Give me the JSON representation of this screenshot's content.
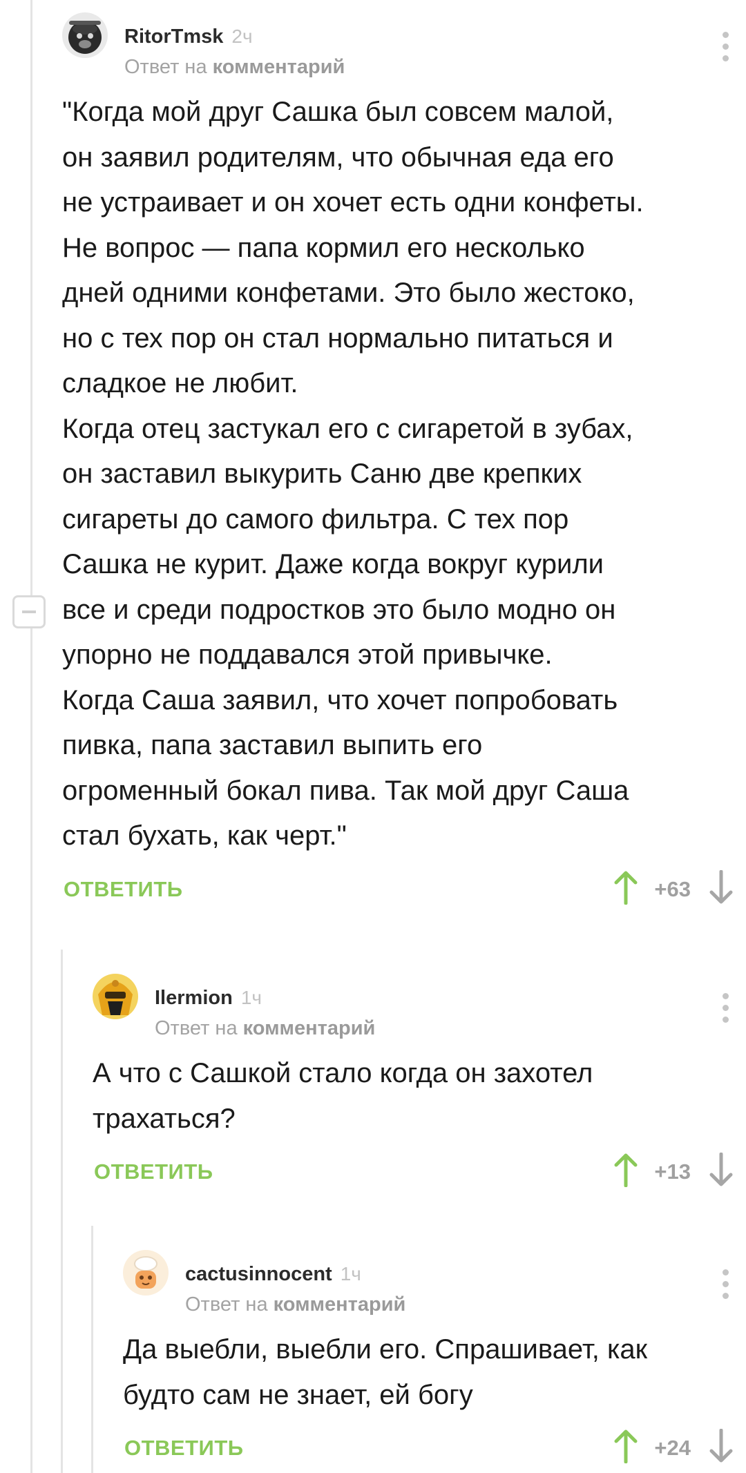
{
  "comments": [
    {
      "author": "RitorTmsk",
      "time": "2ч",
      "reply_prefix": "Ответ на",
      "reply_link": "комментарий",
      "body": [
        "\"Когда мой друг Сашка был совсем малой,",
        "он заявил родителям, что обычная еда его",
        "не устраивает и он хочет есть одни конфеты.",
        "Не вопрос — папа кормил его несколько",
        "дней одними конфетами. Это было жестоко,",
        "но с тех пор он стал нормально питаться и",
        "сладкое не любит.",
        "Когда отец застукал его с сигаретой в зубах,",
        "он заставил выкурить Саню две крепких",
        "сигареты до самого фильтра. С тех пор",
        "Сашка не курит. Даже когда вокруг курили",
        "все и среди подростков это было модно он",
        "упорно не поддавался этой привычке.",
        "Когда Саша заявил, что хочет попробовать",
        "пивка, папа заставил выпить его",
        "огроменный бокал пива. Так мой друг Саша",
        "стал бухать, как черт.\""
      ],
      "reply_button": "ОТВЕТИТЬ",
      "score": "+63",
      "avatar_icon": "bulldog-avatar-icon"
    },
    {
      "author": "Ilermion",
      "time": "1ч",
      "reply_prefix": "Ответ на",
      "reply_link": "комментарий",
      "body": [
        "А что с Сашкой стало когда он захотел",
        "трахаться?"
      ],
      "reply_button": "ОТВЕТИТЬ",
      "score": "+13",
      "avatar_icon": "masked-warrior-avatar-icon"
    },
    {
      "author": "cactusinnocent",
      "time": "1ч",
      "reply_prefix": "Ответ на",
      "reply_link": "комментарий",
      "body": [
        "Да выебли, выебли его. Спрашивает, как",
        "будто сам не знает, ей богу"
      ],
      "reply_button": "ОТВЕТИТЬ",
      "score": "+24",
      "avatar_icon": "cactus-avatar-icon"
    }
  ],
  "colors": {
    "accent_green": "#8ac858",
    "muted_gray": "#a0a0a0",
    "thread_line": "#e4e4e4"
  }
}
